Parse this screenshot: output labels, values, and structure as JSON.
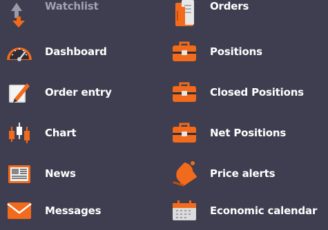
{
  "colors": {
    "background": "#3e3e50",
    "accent": "#f26a1b",
    "text": "#ffffff",
    "muted_text": "#a2a2b2"
  },
  "left_menu": [
    {
      "label": "Watchlist",
      "icon": "watchlist-arrows-icon",
      "muted": true
    },
    {
      "label": "Dashboard",
      "icon": "speedometer-icon"
    },
    {
      "label": "Order entry",
      "icon": "pen-icon"
    },
    {
      "label": "Chart",
      "icon": "candlestick-icon"
    },
    {
      "label": "News",
      "icon": "newspaper-icon"
    },
    {
      "label": "Messages",
      "icon": "envelope-icon"
    }
  ],
  "right_menu": [
    {
      "label": "Orders",
      "icon": "order-book-icon"
    },
    {
      "label": "Positions",
      "icon": "briefcase-icon"
    },
    {
      "label": "Closed Positions",
      "icon": "briefcase-icon"
    },
    {
      "label": "Net Positions",
      "icon": "briefcase-icon"
    },
    {
      "label": "Price alerts",
      "icon": "bell-icon"
    },
    {
      "label": "Economic calendar",
      "icon": "calendar-icon"
    }
  ]
}
